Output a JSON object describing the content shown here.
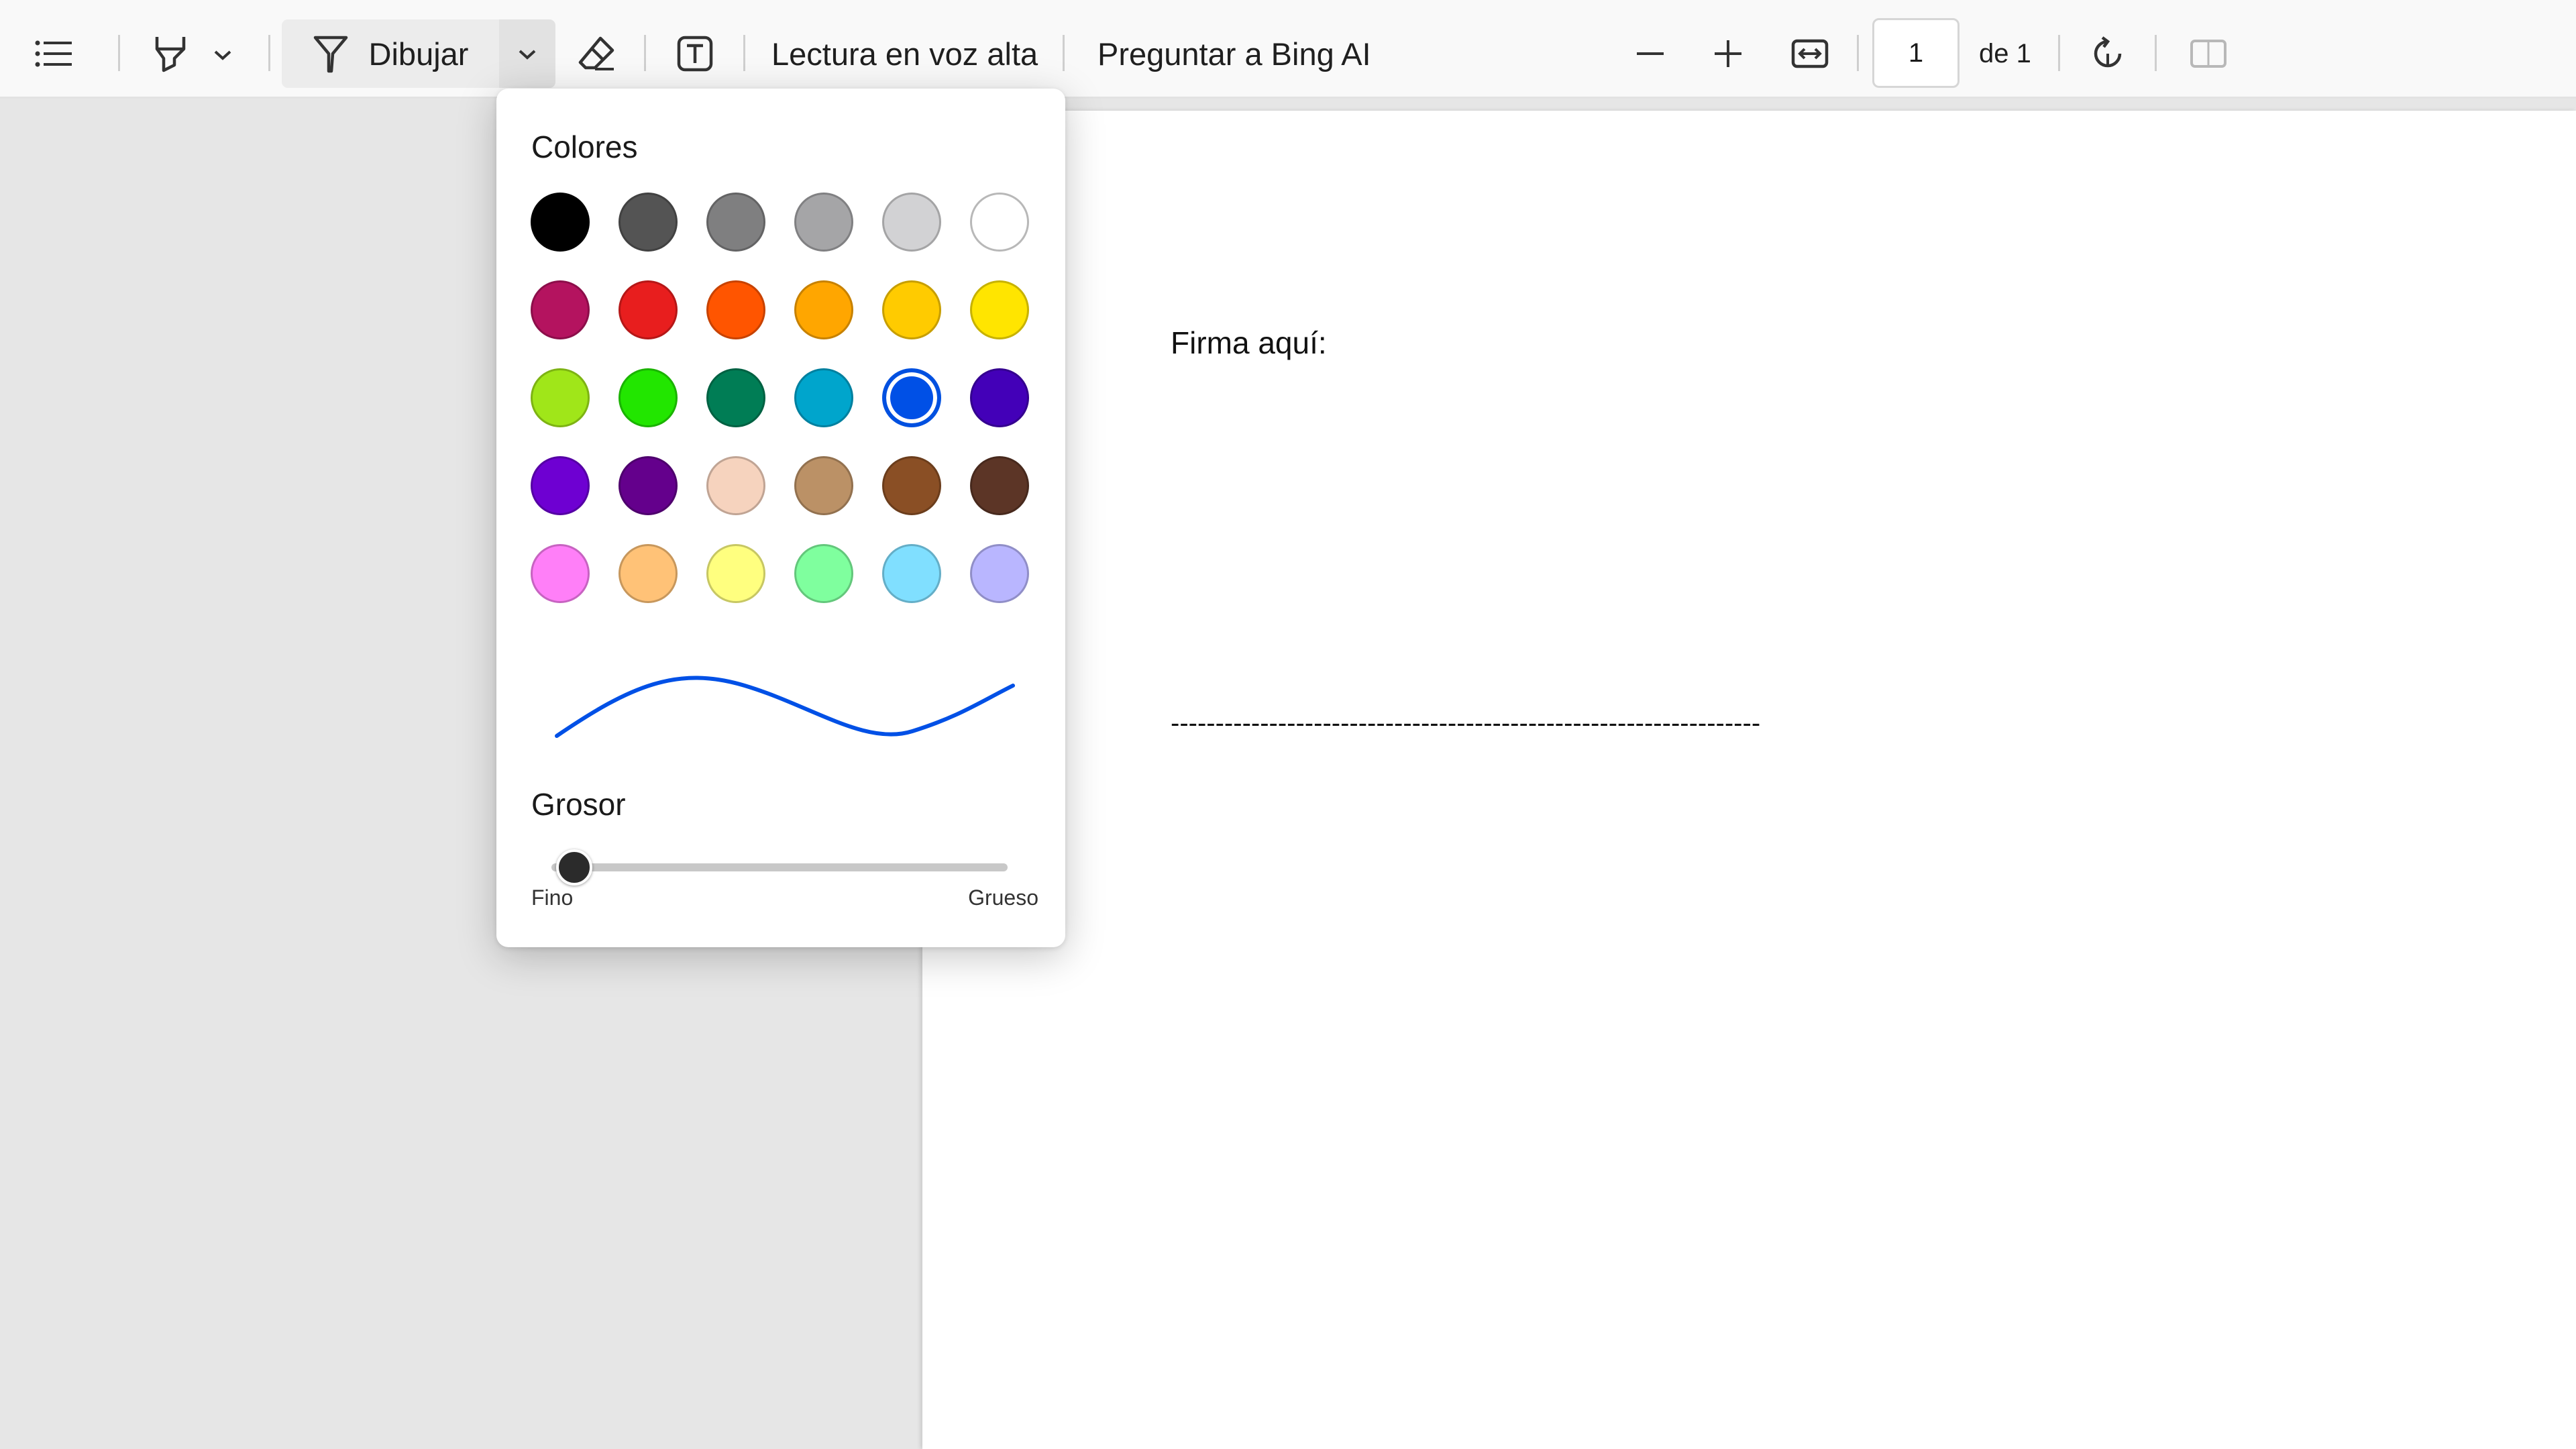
{
  "toolbar": {
    "draw_label": "Dibujar",
    "read_aloud_label": "Lectura en voz alta",
    "ask_bing_label": "Preguntar a Bing AI",
    "page_number": "1",
    "page_total": "de 1",
    "icons": [
      "contents-list-icon",
      "highlight-icon",
      "chevron-down-icon",
      "draw-pen-icon",
      "chevron-down-icon",
      "eraser-icon",
      "text-box-icon",
      "zoom-out-icon",
      "zoom-in-icon",
      "fit-width-icon",
      "rotate-icon",
      "page-view-icon"
    ]
  },
  "document": {
    "label": "Firma aquí:",
    "signature_line": "------------------------------------------------------------------"
  },
  "popup": {
    "colors_title": "Colores",
    "colors": [
      [
        "#000000",
        "#545454",
        "#7f7f80",
        "#a5a5a7",
        "#d2d2d4",
        "#ffffff"
      ],
      [
        "#b4135f",
        "#e81e1e",
        "#ff5500",
        "#ffa600",
        "#ffcb00",
        "#ffe500"
      ],
      [
        "#a0e619",
        "#22e600",
        "#007d55",
        "#00a5cc",
        "#0050e6",
        "#4300b8"
      ],
      [
        "#6e00d2",
        "#64008c",
        "#f6d3be",
        "#bb9166",
        "#8a4f25",
        "#5c3526"
      ],
      [
        "#ff7ff8",
        "#ffc277",
        "#ffff7f",
        "#7fff9e",
        "#80dfff",
        "#b9b6ff"
      ]
    ],
    "selected_color": "#0050e6",
    "thickness_title": "Grosor",
    "thickness_min_label": "Fino",
    "thickness_max_label": "Grueso",
    "thickness_value": 0.05
  }
}
